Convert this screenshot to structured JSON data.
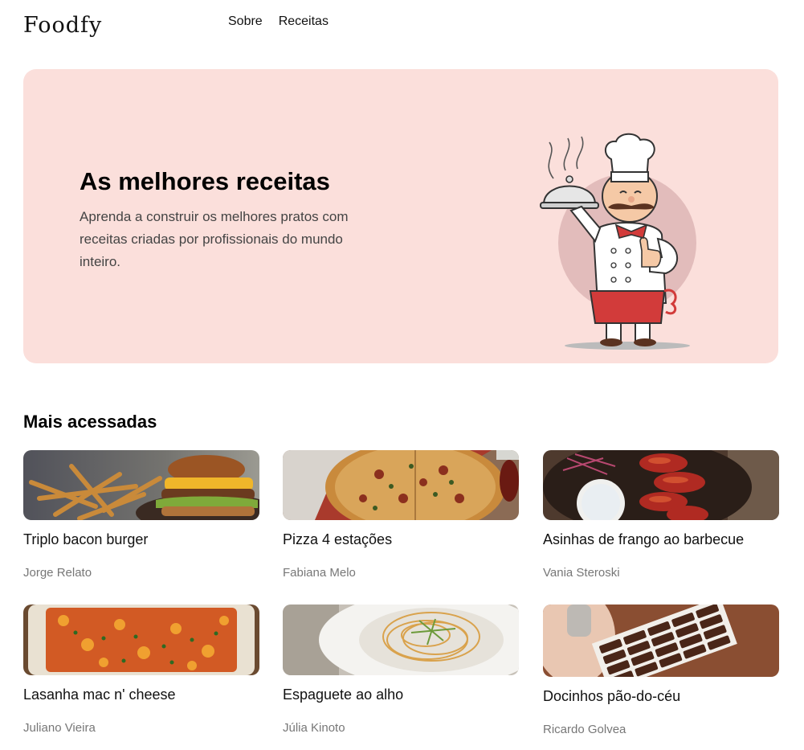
{
  "header": {
    "logo": "Foodfy",
    "nav": [
      "Sobre",
      "Receitas"
    ]
  },
  "hero": {
    "title": "As melhores receitas",
    "text": "Aprenda a construir os melhores pratos com receitas criadas por profissionais do mundo inteiro."
  },
  "section": {
    "title": "Mais acessadas"
  },
  "recipes": [
    {
      "title": "Triplo bacon burger",
      "author": "Jorge Relato",
      "image": "burger-photo"
    },
    {
      "title": "Pizza 4 estações",
      "author": "Fabiana Melo",
      "image": "pizza-photo"
    },
    {
      "title": "Asinhas de frango ao barbecue",
      "author": "Vania Steroski",
      "image": "chicken-wings-photo"
    },
    {
      "title": "Lasanha mac n' cheese",
      "author": "Juliano Vieira",
      "image": "lasagna-photo"
    },
    {
      "title": "Espaguete ao alho",
      "author": "Júlia Kinoto",
      "image": "spaghetti-photo"
    },
    {
      "title": "Docinhos pão-do-céu",
      "author": "Ricardo Golvea",
      "image": "chocolates-photo"
    }
  ],
  "colors": {
    "hero_bg": "#fbdfdb",
    "text_secondary": "#777777"
  }
}
